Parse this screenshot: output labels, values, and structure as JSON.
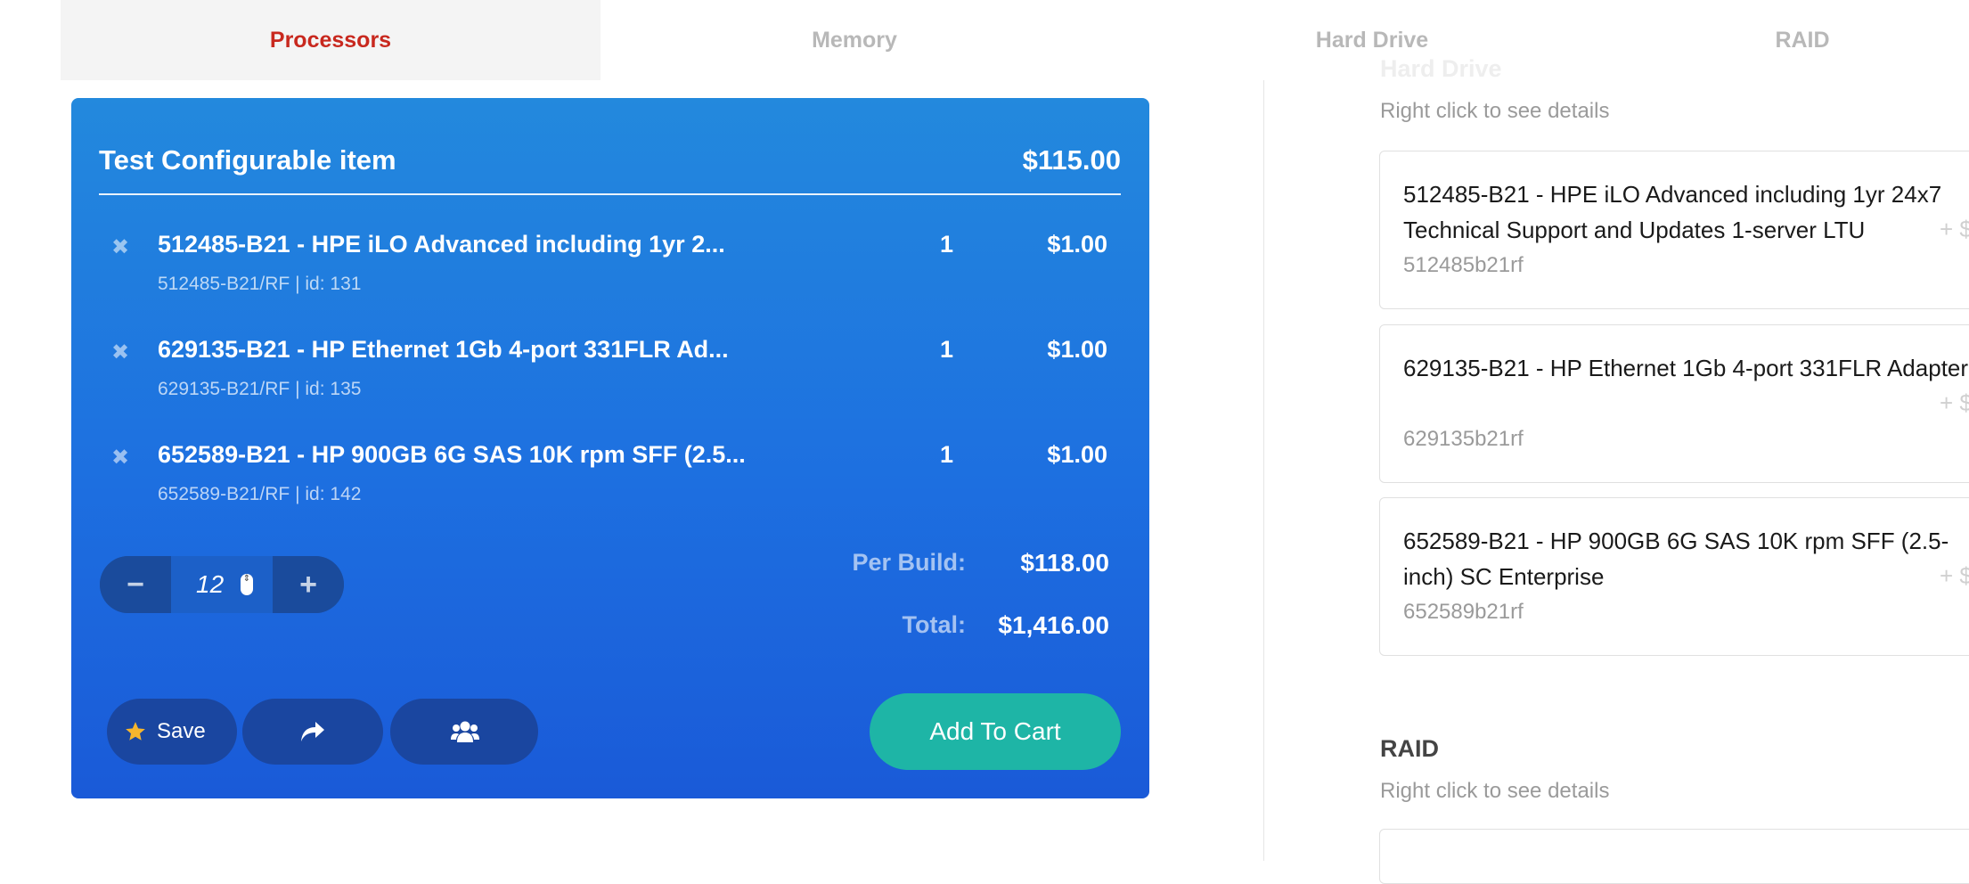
{
  "tabs": [
    {
      "label": "Processors",
      "active": true
    },
    {
      "label": "Memory",
      "active": false
    },
    {
      "label": "Hard Drive",
      "active": false
    },
    {
      "label": "RAID",
      "active": false
    }
  ],
  "build": {
    "title": "Test Configurable item",
    "base_price": "$115.00",
    "remove_icon": "close-icon",
    "items": [
      {
        "name": "512485-B21 - HPE iLO Advanced including 1yr 2...",
        "sub": "512485-B21/RF | id: 131",
        "qty": "1",
        "price": "$1.00"
      },
      {
        "name": "629135-B21 - HP Ethernet 1Gb 4-port 331FLR Ad...",
        "sub": "629135-B21/RF | id: 135",
        "qty": "1",
        "price": "$1.00"
      },
      {
        "name": "652589-B21 - HP 900GB 6G SAS 10K rpm SFF (2.5...",
        "sub": "652589-B21/RF | id: 142",
        "qty": "1",
        "price": "$1.00"
      }
    ],
    "quantity": "12",
    "minus_glyph": "−",
    "plus_glyph": "+",
    "per_build_label": "Per Build:",
    "per_build_value": "$118.00",
    "total_label": "Total:",
    "total_value": "$1,416.00",
    "save_label": "Save",
    "save_icon": "star-icon",
    "share_icon": "share-icon",
    "group_icon": "users-icon",
    "add_to_cart_label": "Add To Cart",
    "colors": {
      "card_top": "#2389dd",
      "card_bottom": "#1a5ad8",
      "add_button": "#1eb5a6",
      "star": "#f5b52e",
      "active_tab": "#c8281e"
    }
  },
  "right_panel": {
    "hard_drive": {
      "title": "Hard Drive",
      "hint": "Right click to see details",
      "parts": [
        {
          "name": "512485-B21 - HPE iLO Advanced including 1yr 24x7 Technical Support and Updates 1-server LTU",
          "sku": "512485b21rf",
          "add": "+ $"
        },
        {
          "name": "629135-B21 - HP Ethernet 1Gb 4-port 331FLR Adapter",
          "sku": "629135b21rf",
          "add": "+ $"
        },
        {
          "name": "652589-B21 - HP 900GB 6G SAS 10K rpm SFF (2.5-inch) SC Enterprise",
          "sku": "652589b21rf",
          "add": "+ $"
        }
      ]
    },
    "raid": {
      "title": "RAID",
      "hint": "Right click to see details"
    }
  }
}
